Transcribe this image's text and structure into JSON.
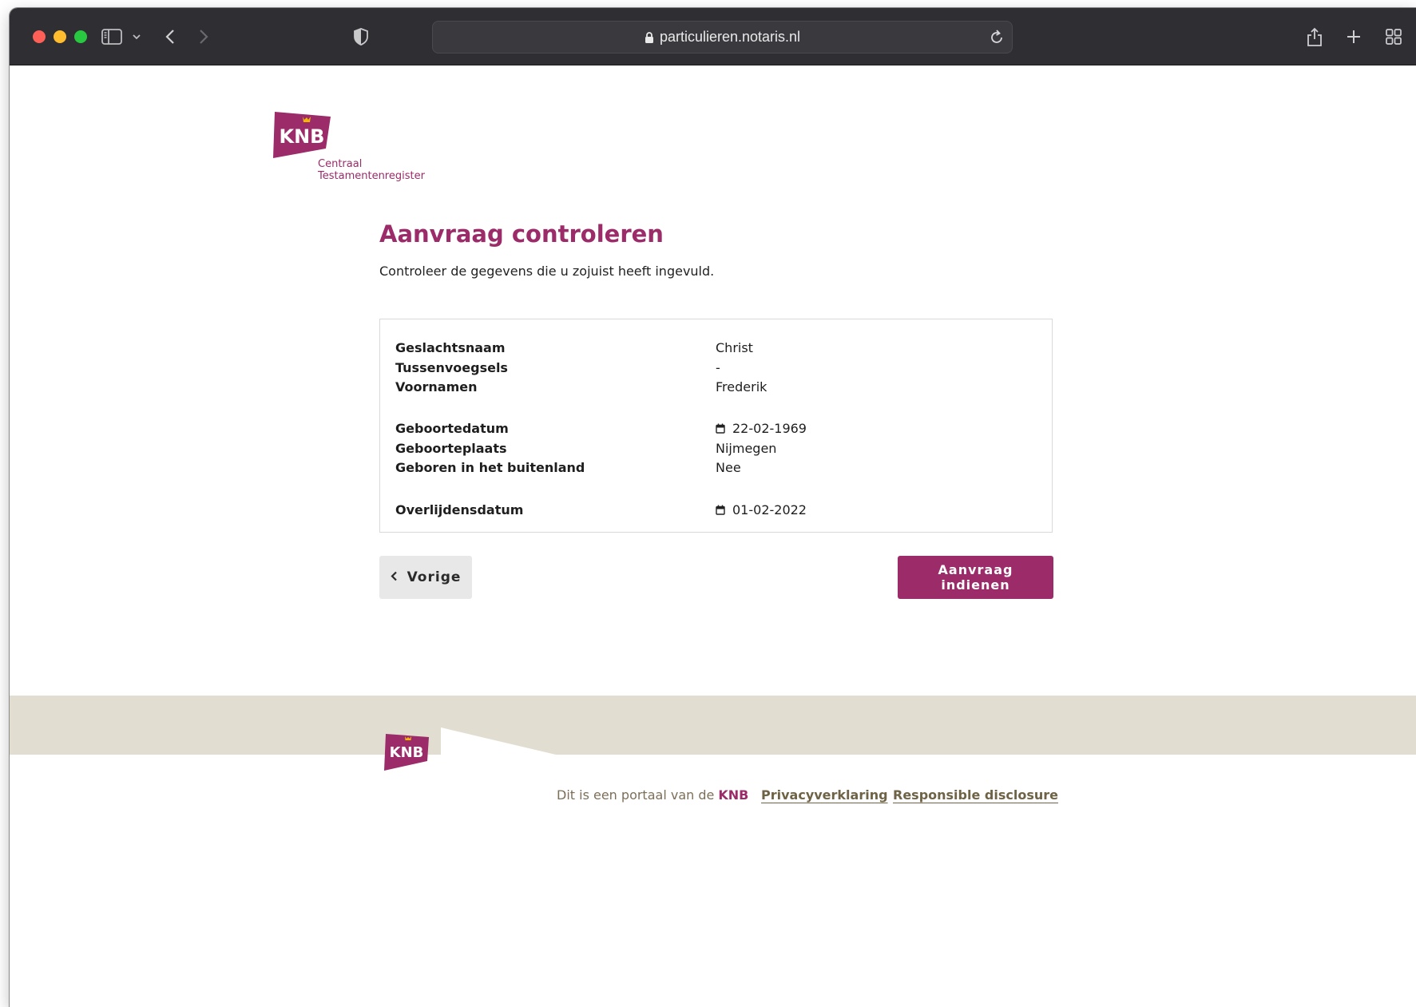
{
  "browser": {
    "url": "particulieren.notaris.nl"
  },
  "brand": {
    "logo_text": "KNB",
    "subtitle_line1": "Centraal",
    "subtitle_line2": "Testamentenregister",
    "primary_color": "#9b2b69",
    "footer_color": "#e2ddd1"
  },
  "main": {
    "title": "Aanvraag controleren",
    "intro": "Controleer de gegevens die u zojuist heeft ingevuld.",
    "fields": [
      {
        "label": "Geslachtsnaam",
        "value": "Christ"
      },
      {
        "label": "Tussenvoegsels",
        "value": "-"
      },
      {
        "label": "Voornamen",
        "value": "Frederik"
      },
      {
        "label": "Geboortedatum",
        "value": "22-02-1969",
        "icon": "calendar-icon"
      },
      {
        "label": "Geboorteplaats",
        "value": "Nijmegen"
      },
      {
        "label": "Geboren in het buitenland",
        "value": "Nee"
      },
      {
        "label": "Overlijdensdatum",
        "value": "01-02-2022",
        "icon": "calendar-icon"
      }
    ],
    "prev_label": "Vorige",
    "submit_label": "Aanvraag indienen"
  },
  "footer": {
    "logo_text": "KNB",
    "portal_text": "Dit is een portaal van de",
    "portal_brand": "KNB",
    "privacy_label": "Privacyverklaring",
    "disclosure_label": "Responsible disclosure"
  }
}
